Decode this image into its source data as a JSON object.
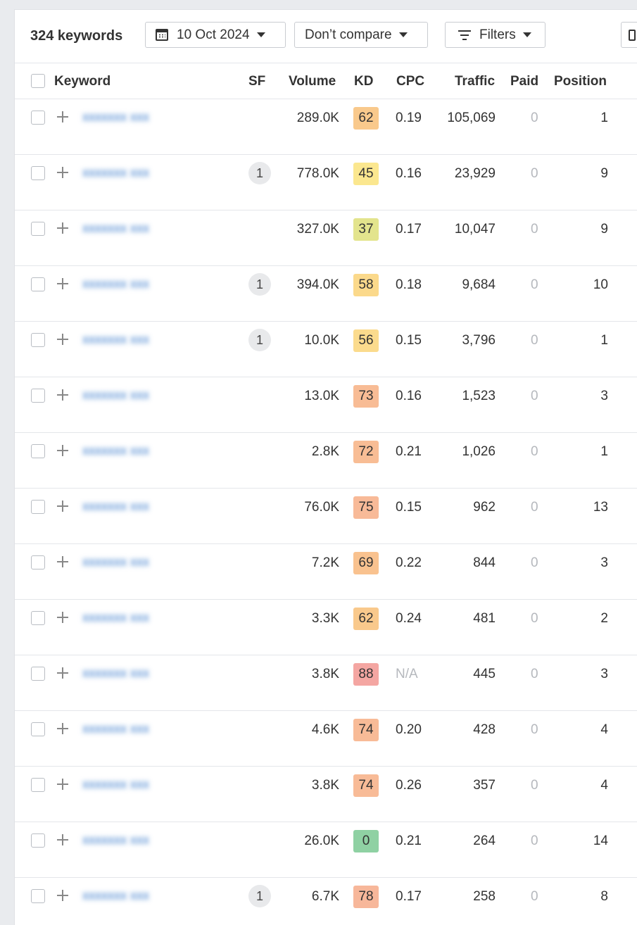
{
  "toolbar": {
    "count": "324 keywords",
    "date": "10 Oct 2024",
    "compare": "Don’t compare",
    "filters": "Filters",
    "calendar_icon": "calendar-icon",
    "filter_icon": "filter-icon"
  },
  "columns": {
    "keyword": "Keyword",
    "sf": "SF",
    "volume": "Volume",
    "kd": "KD",
    "cpc": "CPC",
    "traffic": "Traffic",
    "paid": "Paid",
    "position": "Position"
  },
  "kd_colors": {
    "green": "#8fd1a3",
    "yellow_green": "#e0e48a",
    "yellow": "#fbe48a",
    "light_orange": "#fbd58f",
    "orange": "#f9c08d",
    "deep_orange": "#f8b998",
    "red": "#f4a6a2"
  },
  "rows": [
    {
      "keyword": "(blurred)",
      "sf": "",
      "volume": "289.0K",
      "kd": "62",
      "kd_color": "#f9c98c",
      "cpc": "0.19",
      "traffic": "105,069",
      "paid": "0",
      "position": "1"
    },
    {
      "keyword": "(blurred)",
      "sf": "1",
      "volume": "778.0K",
      "kd": "45",
      "kd_color": "#fbe78f",
      "cpc": "0.16",
      "traffic": "23,929",
      "paid": "0",
      "position": "9"
    },
    {
      "keyword": "(blurred)",
      "sf": "",
      "volume": "327.0K",
      "kd": "37",
      "kd_color": "#e3e48d",
      "cpc": "0.17",
      "traffic": "10,047",
      "paid": "0",
      "position": "9"
    },
    {
      "keyword": "(blurred)",
      "sf": "1",
      "volume": "394.0K",
      "kd": "58",
      "kd_color": "#fbd98b",
      "cpc": "0.18",
      "traffic": "9,684",
      "paid": "0",
      "position": "10"
    },
    {
      "keyword": "(blurred)",
      "sf": "1",
      "volume": "10.0K",
      "kd": "56",
      "kd_color": "#fbdb8d",
      "cpc": "0.15",
      "traffic": "3,796",
      "paid": "0",
      "position": "1"
    },
    {
      "keyword": "(blurred)",
      "sf": "",
      "volume": "13.0K",
      "kd": "73",
      "kd_color": "#f8bc95",
      "cpc": "0.16",
      "traffic": "1,523",
      "paid": "0",
      "position": "3"
    },
    {
      "keyword": "(blurred)",
      "sf": "",
      "volume": "2.8K",
      "kd": "72",
      "kd_color": "#f8bd95",
      "cpc": "0.21",
      "traffic": "1,026",
      "paid": "0",
      "position": "1"
    },
    {
      "keyword": "(blurred)",
      "sf": "",
      "volume": "76.0K",
      "kd": "75",
      "kd_color": "#f8ba98",
      "cpc": "0.15",
      "traffic": "962",
      "paid": "0",
      "position": "13"
    },
    {
      "keyword": "(blurred)",
      "sf": "",
      "volume": "7.2K",
      "kd": "69",
      "kd_color": "#f9c28f",
      "cpc": "0.22",
      "traffic": "844",
      "paid": "0",
      "position": "3"
    },
    {
      "keyword": "(blurred)",
      "sf": "",
      "volume": "3.3K",
      "kd": "62",
      "kd_color": "#f9c98c",
      "cpc": "0.24",
      "traffic": "481",
      "paid": "0",
      "position": "2"
    },
    {
      "keyword": "(blurred)",
      "sf": "",
      "volume": "3.8K",
      "kd": "88",
      "kd_color": "#f4a6a2",
      "cpc": "N/A",
      "traffic": "445",
      "paid": "0",
      "position": "3"
    },
    {
      "keyword": "(blurred)",
      "sf": "",
      "volume": "4.6K",
      "kd": "74",
      "kd_color": "#f8bb97",
      "cpc": "0.20",
      "traffic": "428",
      "paid": "0",
      "position": "4"
    },
    {
      "keyword": "(blurred)",
      "sf": "",
      "volume": "3.8K",
      "kd": "74",
      "kd_color": "#f8bb97",
      "cpc": "0.26",
      "traffic": "357",
      "paid": "0",
      "position": "4"
    },
    {
      "keyword": "(blurred)",
      "sf": "",
      "volume": "26.0K",
      "kd": "0",
      "kd_color": "#8fd1a3",
      "cpc": "0.21",
      "traffic": "264",
      "paid": "0",
      "position": "14"
    },
    {
      "keyword": "(blurred)",
      "sf": "1",
      "volume": "6.7K",
      "kd": "78",
      "kd_color": "#f7b79a",
      "cpc": "0.17",
      "traffic": "258",
      "paid": "0",
      "position": "8"
    }
  ]
}
